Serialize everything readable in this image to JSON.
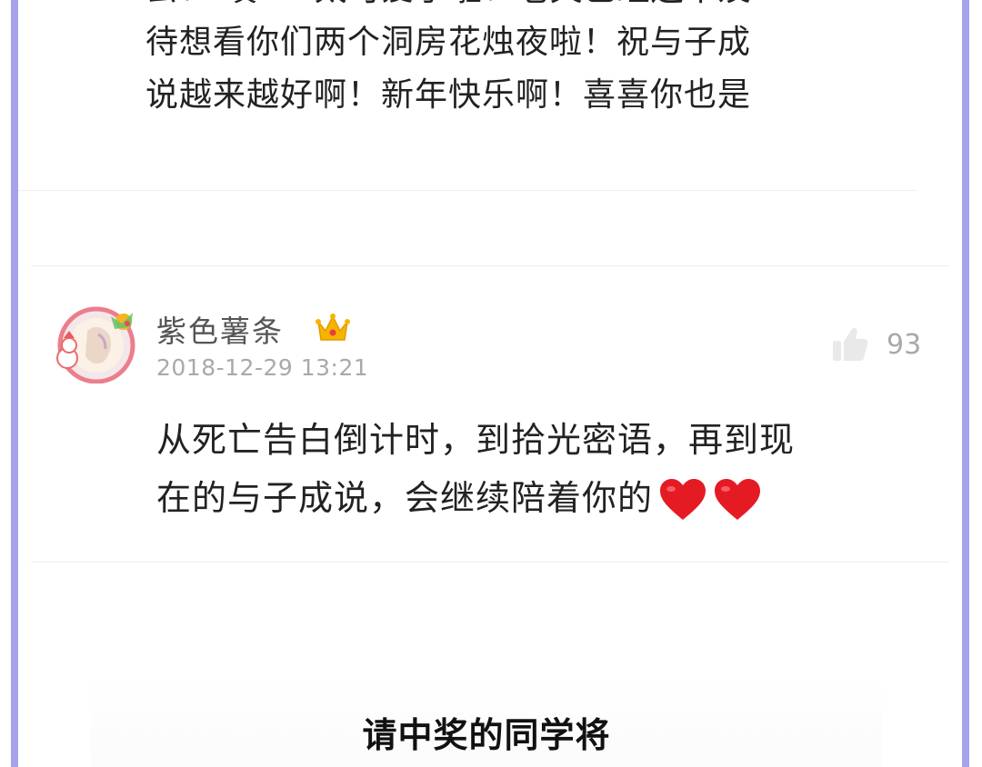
{
  "previous_comment": {
    "lines": [
      "去！ 噗.....太可爱了啦！老夫已经迫不及",
      "待想看你们两个洞房花烛夜啦！祝与子成",
      "说越来越好啊！新年快乐啊！喜喜你也是"
    ]
  },
  "comment": {
    "username": "紫色薯条",
    "badge_icon": "crown-icon",
    "timestamp": "2018-12-29 13:21",
    "like_icon": "thumbs-up-icon",
    "like_count": "93",
    "text_lines": [
      "从死亡告白倒计时，到拾光密语，再到现",
      "在的与子成说，会继续陪着你的"
    ],
    "emoji": [
      "heart-emoji",
      "heart-emoji"
    ]
  },
  "overlay": {
    "caption": "请中奖的同学将"
  },
  "colors": {
    "frame": "#a6a3ec",
    "text_primary": "#222222",
    "text_secondary": "#555555",
    "text_muted": "#a9a9a9",
    "heart": "#e51b23",
    "crown": "#f5b400"
  }
}
